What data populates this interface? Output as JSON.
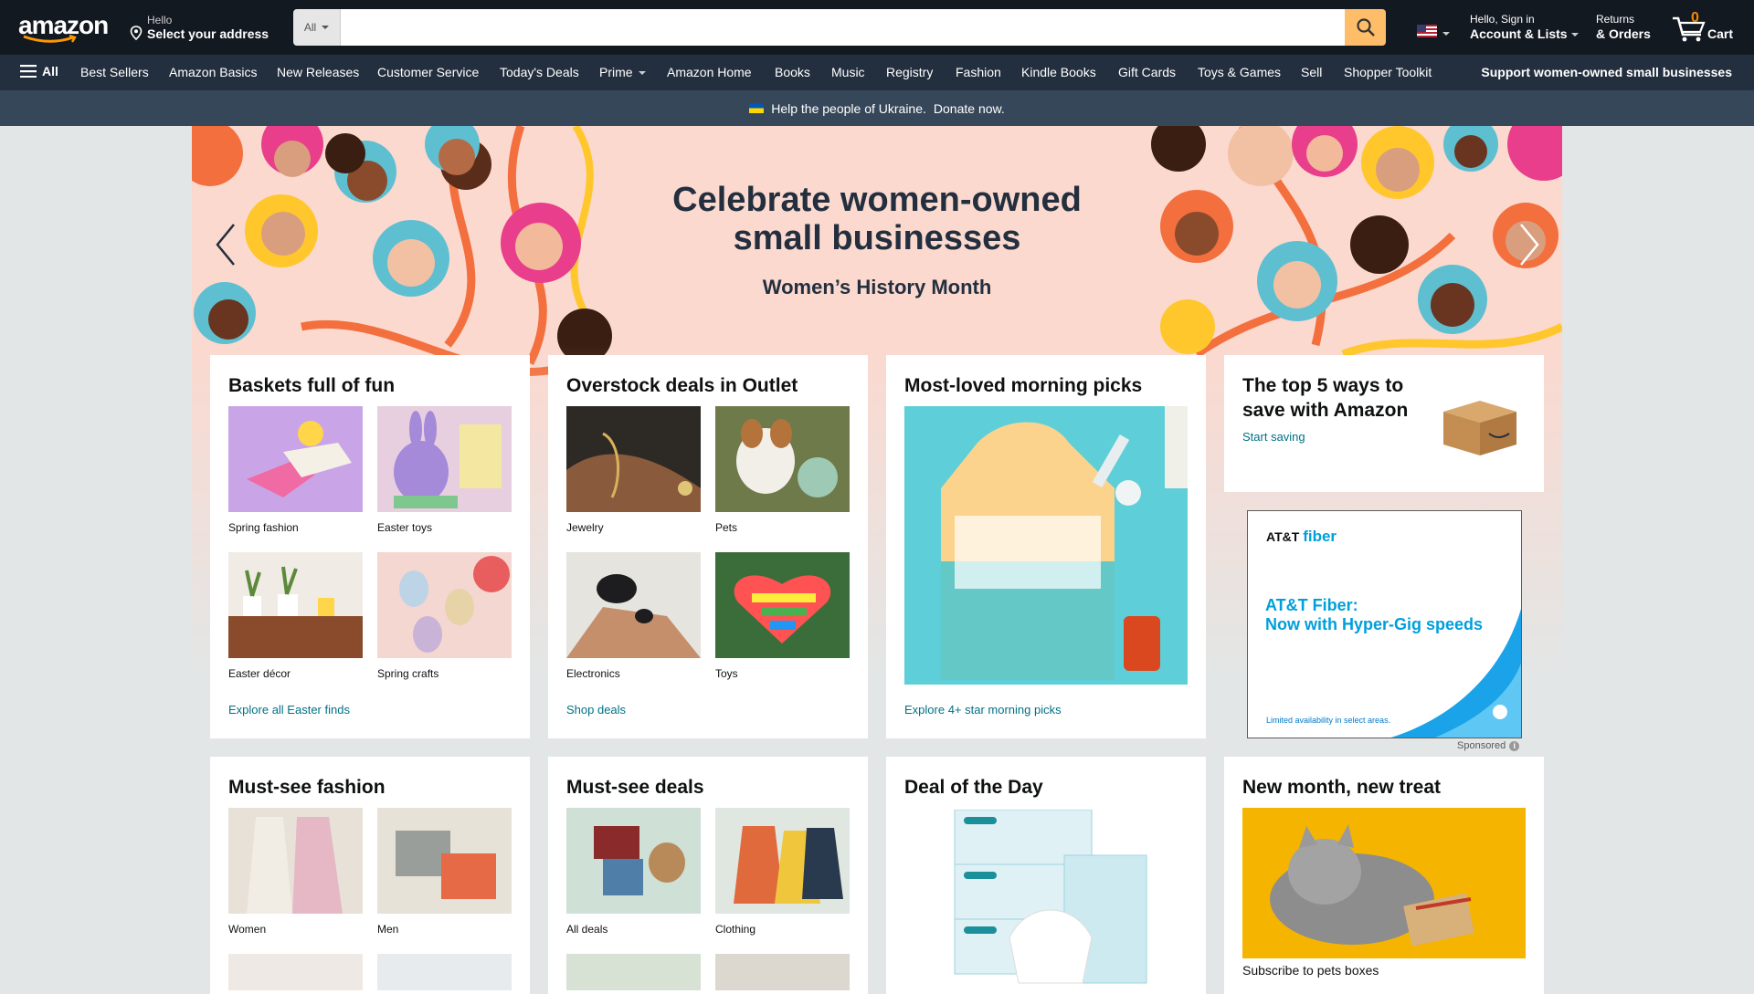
{
  "header": {
    "logo": "amazon",
    "deliver_line1": "Hello",
    "deliver_line2": "Select your address",
    "search_category": "All",
    "search_placeholder": "",
    "account_line1": "Hello, Sign in",
    "account_line2": "Account & Lists",
    "returns_line1": "Returns",
    "returns_line2": "& Orders",
    "cart_count": "0",
    "cart_label": "Cart"
  },
  "subnav": {
    "all": "All",
    "items": [
      "Best Sellers",
      "Amazon Basics",
      "New Releases",
      "Customer Service",
      "Today's Deals",
      "Prime",
      "Amazon Home",
      "Books",
      "Music",
      "Registry",
      "Fashion",
      "Kindle Books",
      "Gift Cards",
      "Toys & Games",
      "Sell",
      "Shopper Toolkit"
    ],
    "promo": "Support women-owned small businesses"
  },
  "ukraine": {
    "text": "Help the people of Ukraine.",
    "link": "Donate now."
  },
  "hero": {
    "title_line1": "Celebrate women-owned",
    "title_line2": "small businesses",
    "subtitle": "Women’s History Month"
  },
  "cards": [
    {
      "title": "Baskets full of fun",
      "tiles": [
        "Spring fashion",
        "Easter toys",
        "Easter décor",
        "Spring crafts"
      ],
      "link": "Explore all Easter finds"
    },
    {
      "title": "Overstock deals in Outlet",
      "tiles": [
        "Jewelry",
        "Pets",
        "Electronics",
        "Toys"
      ],
      "link": "Shop deals"
    },
    {
      "title": "Most-loved morning picks",
      "link": "Explore 4+ star morning picks"
    },
    {
      "title_line1": "The top 5 ways to",
      "title_line2": "save with Amazon",
      "link": "Start saving"
    },
    {
      "title": "Must-see fashion",
      "tiles": [
        "Women",
        "Men"
      ]
    },
    {
      "title": "Must-see deals",
      "tiles": [
        "All deals",
        "Clothing"
      ]
    },
    {
      "title": "Deal of the Day"
    },
    {
      "title": "New month, new treat",
      "caption": "Subscribe to pets boxes"
    }
  ],
  "ad": {
    "brand": "AT&T",
    "brand_suffix": "fiber",
    "headline_line1": "AT&T Fiber:",
    "headline_line2": "Now with Hyper-Gig speeds",
    "fine_print": "Limited availability in select areas.",
    "sponsored": "Sponsored"
  },
  "colors": {
    "nav_dark": "#131921",
    "nav_sub": "#232f3e",
    "banner": "#37475a",
    "search_button": "#febd69",
    "link": "#007185",
    "cart_count": "#f08804"
  }
}
